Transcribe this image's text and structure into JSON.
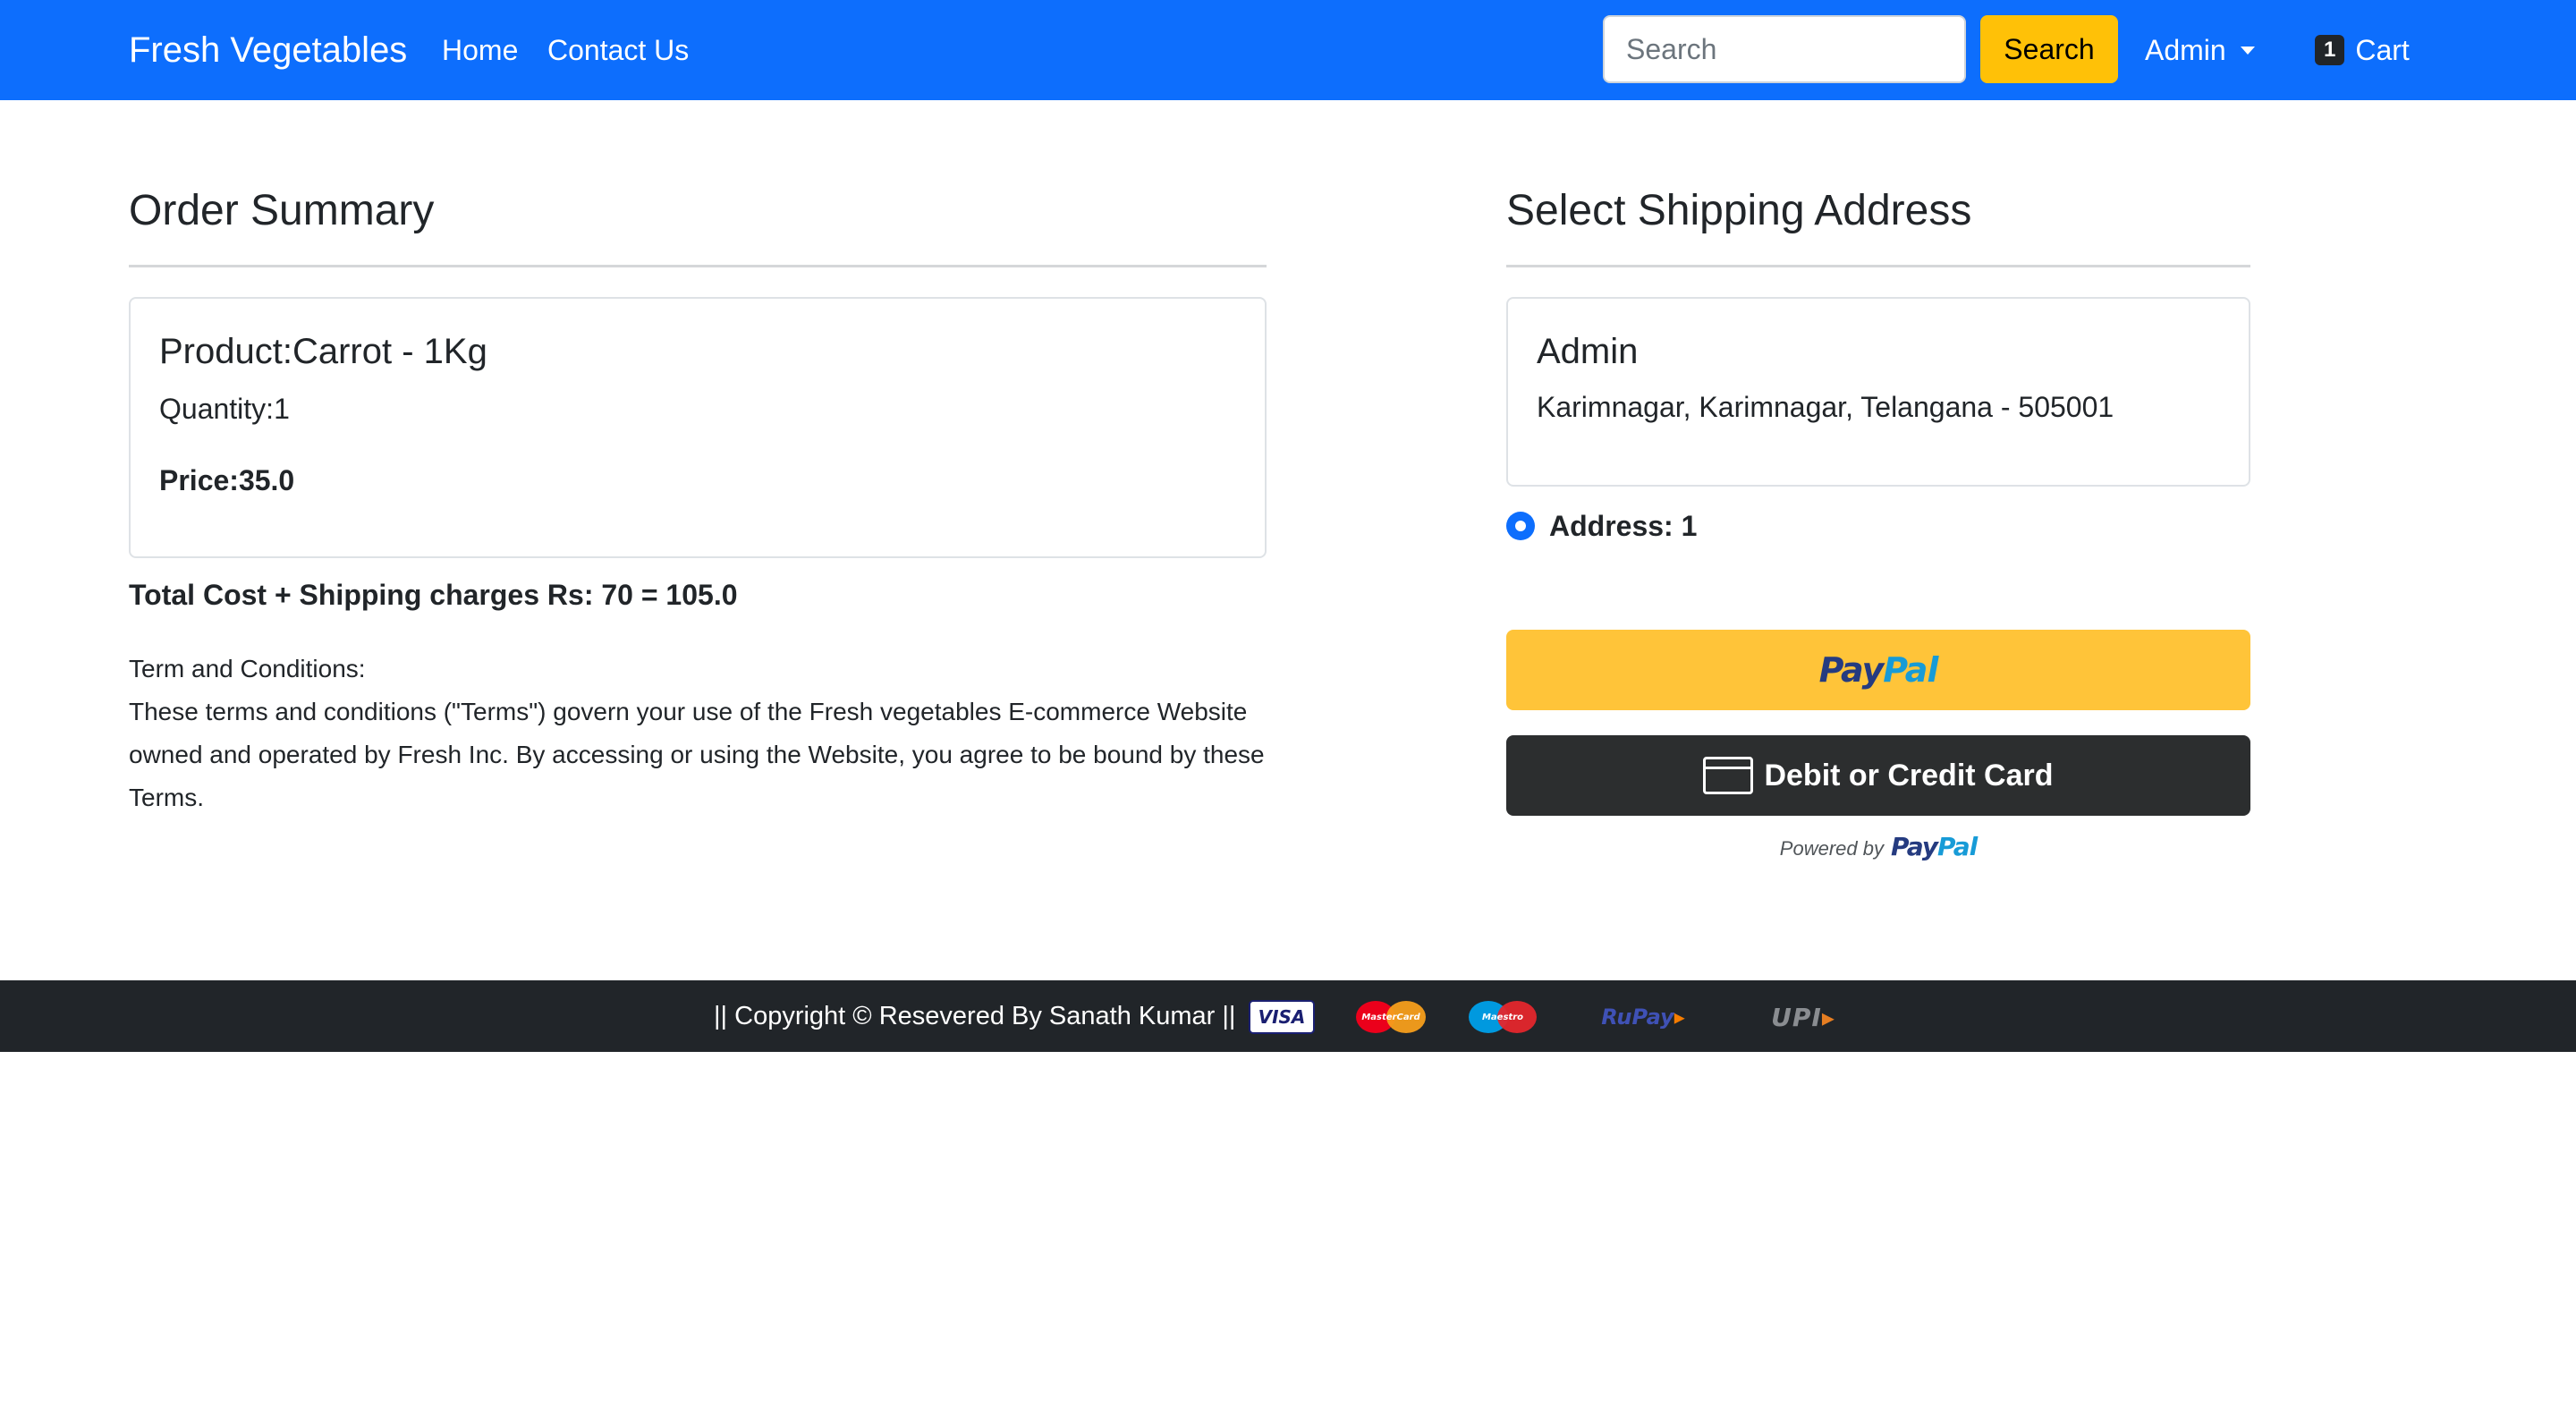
{
  "navbar": {
    "brand": "Fresh Vegetables",
    "links": [
      "Home",
      "Contact Us"
    ],
    "search_placeholder": "Search",
    "search_button": "Search",
    "user_menu": "Admin",
    "cart_count": "1",
    "cart_label": "Cart"
  },
  "order_summary": {
    "title": "Order Summary",
    "product": "Product:Carrot - 1Kg",
    "quantity": "Quantity:1",
    "price": "Price:35.0",
    "total_line": "Total Cost + Shipping charges Rs: 70 = 105.0",
    "terms_title": "Term and Conditions:",
    "terms_body": "These terms and conditions (\"Terms\") govern your use of the Fresh vegetables E-commerce Website owned and operated by Fresh Inc. By accessing or using the Website, you agree to be bound by these Terms."
  },
  "shipping": {
    "title": "Select Shipping Address",
    "name": "Admin",
    "address": "Karimnagar, Karimnagar, Telangana - 505001",
    "radio_label": "Address: 1",
    "radio_selected": true
  },
  "payment": {
    "paypal_pay": "Pay",
    "paypal_pal": "Pal",
    "card_button": "Debit or Credit Card",
    "powered_by": "Powered by"
  },
  "footer": {
    "copyright": "|| Copyright © Resevered By Sanath Kumar ||",
    "visa": "VISA",
    "mastercard": "MasterCard",
    "maestro": "Maestro",
    "rupay_main": "RuPay",
    "upi_main": "UPI"
  },
  "colors": {
    "primary": "#0d6efd",
    "warning": "#ffc107",
    "paypal_yellow": "#ffc439",
    "dark": "#212529"
  },
  "icons": [
    "caret-down-icon",
    "credit-card-icon",
    "radio-checked-icon"
  ]
}
